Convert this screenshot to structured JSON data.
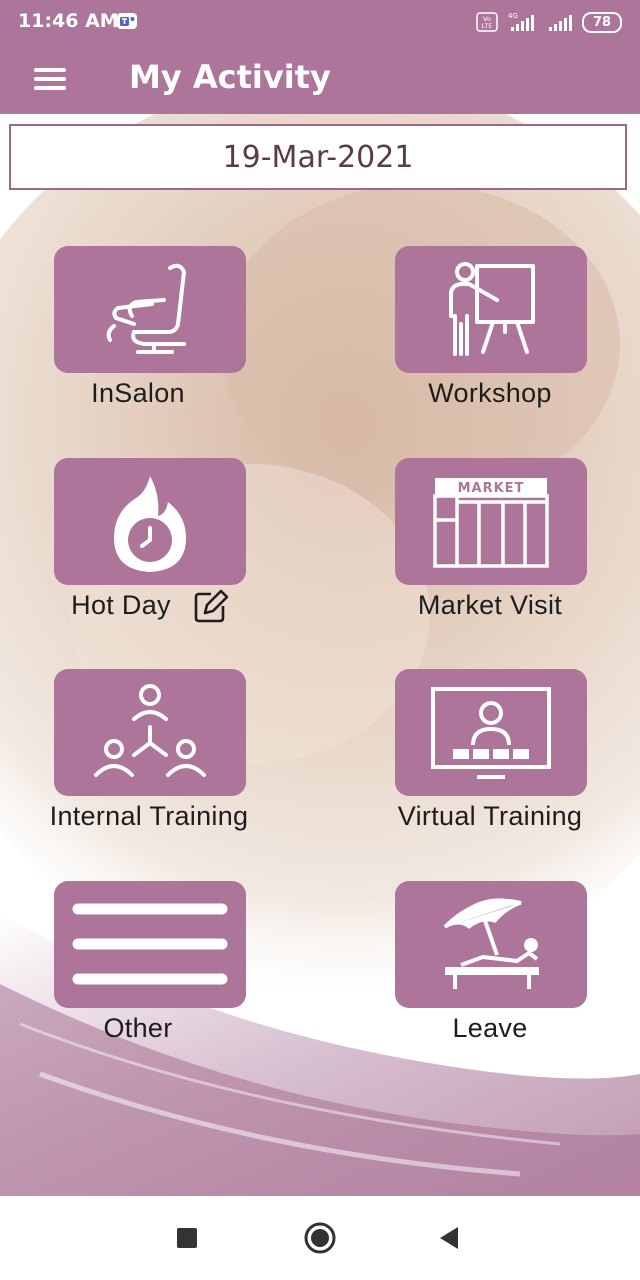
{
  "status_bar": {
    "time": "11:46 AM",
    "battery": "78",
    "volte": "Vo LTE",
    "network": "4G"
  },
  "app_bar": {
    "title": "My Activity",
    "menu_icon": "hamburger-menu-icon"
  },
  "date_picker": {
    "value": "19-Mar-2021"
  },
  "activities": [
    {
      "label": "InSalon",
      "icon": "salon-chair-icon"
    },
    {
      "label": "Workshop",
      "icon": "presentation-board-icon"
    },
    {
      "label": "Hot Day",
      "icon": "flame-clock-icon"
    },
    {
      "label": "Market Visit",
      "icon": "market-store-icon",
      "sign": "MARKET"
    },
    {
      "label": "Internal Training",
      "icon": "team-network-icon"
    },
    {
      "label": "Virtual Training",
      "icon": "monitor-user-icon"
    },
    {
      "label": "Other",
      "icon": "list-lines-icon"
    },
    {
      "label": "Leave",
      "icon": "beach-umbrella-icon"
    }
  ],
  "colors": {
    "primary": "#ac7599",
    "tile": "#ac7599",
    "date_border": "#9b6a8a",
    "label_text": "#1d1d1d"
  },
  "nav_bar": {
    "recents": "square-recents-icon",
    "home": "circle-home-icon",
    "back": "triangle-back-icon"
  }
}
